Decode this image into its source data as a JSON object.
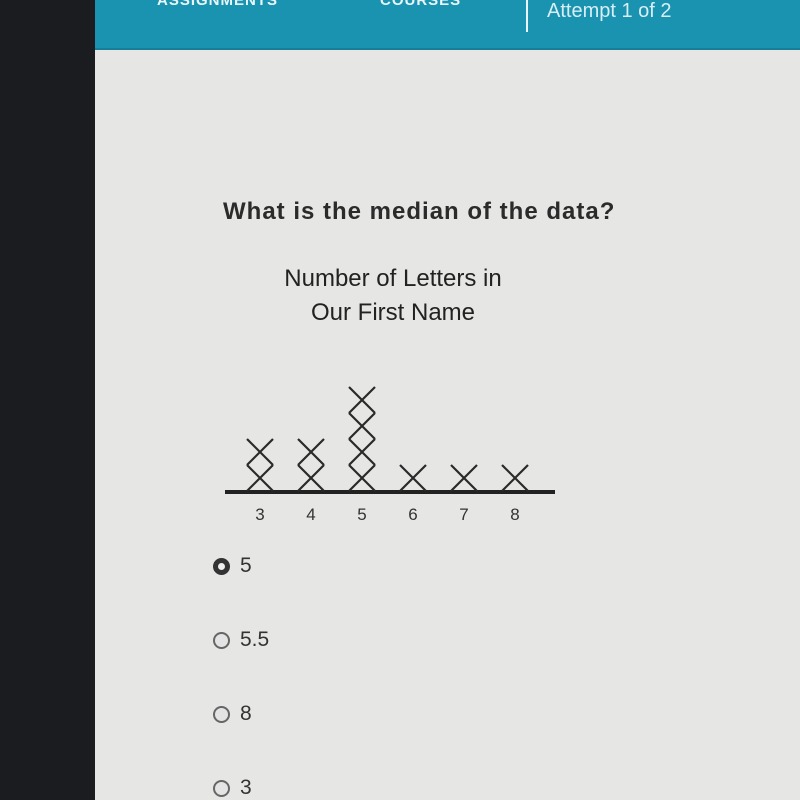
{
  "header": {
    "nav": [
      "ASSIGNMENTS",
      "COURSES"
    ],
    "attempt": "Attempt 1 of 2"
  },
  "question": "What is the median of the data?",
  "chart_data": {
    "type": "dot_plot",
    "title": "Number of Letters in Our First Name",
    "title_lines": [
      "Number of Letters in",
      "Our First Name"
    ],
    "categories": [
      3,
      4,
      5,
      6,
      7,
      8
    ],
    "tick_labels": [
      "3",
      "4",
      "5",
      "6",
      "7",
      "8"
    ],
    "values": [
      2,
      2,
      4,
      1,
      1,
      1
    ],
    "marker": "X",
    "xlabel": "",
    "ylabel": ""
  },
  "choices": [
    {
      "label": "5",
      "selected": true
    },
    {
      "label": "5.5",
      "selected": false
    },
    {
      "label": "8",
      "selected": false
    },
    {
      "label": "3",
      "selected": false
    }
  ]
}
